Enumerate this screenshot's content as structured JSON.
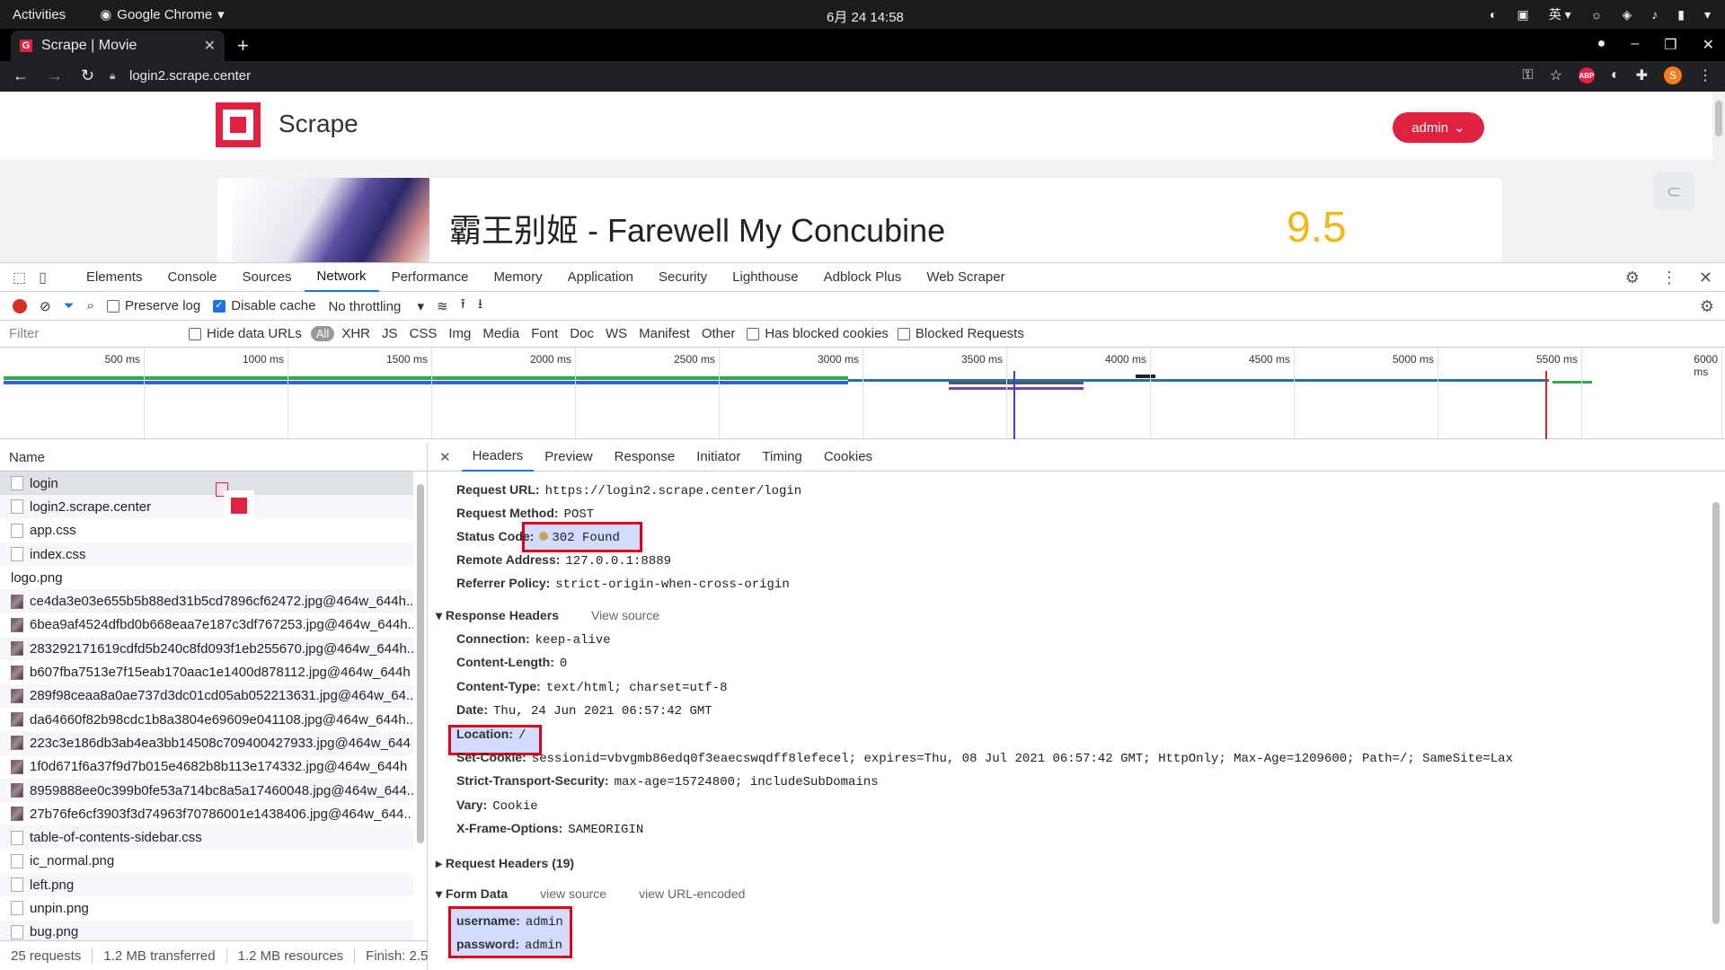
{
  "os_bar": {
    "activities": "Activities",
    "app": "Google Chrome",
    "clock": "6月 24 14:58",
    "ime": "英"
  },
  "browser": {
    "tab_title": "Scrape | Movie",
    "url": "login2.scrape.center"
  },
  "page": {
    "brand": "Scrape",
    "admin_button": "admin",
    "movie_title": "霸王别姬 - Farewell My Concubine",
    "score": "9.5"
  },
  "devtools": {
    "tabs": [
      "Elements",
      "Console",
      "Sources",
      "Network",
      "Performance",
      "Memory",
      "Application",
      "Security",
      "Lighthouse",
      "Adblock Plus",
      "Web Scraper"
    ],
    "active_tab": "Network",
    "toolbar": {
      "preserve_log": "Preserve log",
      "preserve_log_checked": false,
      "disable_cache": "Disable cache",
      "disable_cache_checked": true,
      "throttling": "No throttling"
    },
    "filter": {
      "placeholder": "Filter",
      "hide_data_urls": "Hide data URLs",
      "all": "All",
      "types": [
        "XHR",
        "JS",
        "CSS",
        "Img",
        "Media",
        "Font",
        "Doc",
        "WS",
        "Manifest",
        "Other"
      ],
      "has_blocked_cookies": "Has blocked cookies",
      "blocked_requests": "Blocked Requests"
    },
    "timeline_ticks": [
      "500 ms",
      "1000 ms",
      "1500 ms",
      "2000 ms",
      "2500 ms",
      "3000 ms",
      "3500 ms",
      "4000 ms",
      "4500 ms",
      "5000 ms",
      "5500 ms",
      "6000 ms"
    ],
    "name_header": "Name",
    "requests": [
      {
        "name": "login",
        "icon": "doc"
      },
      {
        "name": "login2.scrape.center",
        "icon": "doc"
      },
      {
        "name": "app.css",
        "icon": "doc"
      },
      {
        "name": "index.css",
        "icon": "doc"
      },
      {
        "name": "logo.png",
        "icon": "logo"
      },
      {
        "name": "ce4da3e03e655b5b88ed31b5cd7896cf62472.jpg@464w_644h..",
        "icon": "img"
      },
      {
        "name": "6bea9af4524dfbd0b668eaa7e187c3df767253.jpg@464w_644h..",
        "icon": "img"
      },
      {
        "name": "283292171619cdfd5b240c8fd093f1eb255670.jpg@464w_644h..",
        "icon": "img"
      },
      {
        "name": "b607fba7513e7f15eab170aac1e1400d878112.jpg@464w_644h",
        "icon": "img"
      },
      {
        "name": "289f98ceaa8a0ae737d3dc01cd05ab052213631.jpg@464w_64..",
        "icon": "img"
      },
      {
        "name": "da64660f82b98cdc1b8a3804e69609e041108.jpg@464w_644h..",
        "icon": "img"
      },
      {
        "name": "223c3e186db3ab4ea3bb14508c709400427933.jpg@464w_644",
        "icon": "img"
      },
      {
        "name": "1f0d671f6a37f9d7b015e4682b8b113e174332.jpg@464w_644h",
        "icon": "img"
      },
      {
        "name": "8959888ee0c399b0fe53a714bc8a5a17460048.jpg@464w_644..",
        "icon": "img"
      },
      {
        "name": "27b76fe6cf3903f3d74963f70786001e1438406.jpg@464w_644..",
        "icon": "img"
      },
      {
        "name": "table-of-contents-sidebar.css",
        "icon": "doc"
      },
      {
        "name": "ic_normal.png",
        "icon": "doc"
      },
      {
        "name": "left.png",
        "icon": "doc"
      },
      {
        "name": "unpin.png",
        "icon": "doc"
      },
      {
        "name": "bug.png",
        "icon": "doc"
      }
    ],
    "status": {
      "requests": "25 requests",
      "transferred": "1.2 MB transferred",
      "resources": "1.2 MB resources",
      "finish": "Finish: 2.5"
    },
    "detail_tabs": [
      "Headers",
      "Preview",
      "Response",
      "Initiator",
      "Timing",
      "Cookies"
    ],
    "general": {
      "request_url": {
        "k": "Request URL:",
        "v": "https://login2.scrape.center/login"
      },
      "request_method": {
        "k": "Request Method:",
        "v": "POST"
      },
      "status_code": {
        "k": "Status Code:",
        "v": "302 Found"
      },
      "remote_address": {
        "k": "Remote Address:",
        "v": "127.0.0.1:8889"
      },
      "referrer_policy": {
        "k": "Referrer Policy:",
        "v": "strict-origin-when-cross-origin"
      }
    },
    "response_headers_title": "Response Headers",
    "view_source": "View source",
    "response_headers": [
      {
        "k": "Connection:",
        "v": "keep-alive"
      },
      {
        "k": "Content-Length:",
        "v": "0"
      },
      {
        "k": "Content-Type:",
        "v": "text/html; charset=utf-8"
      },
      {
        "k": "Date:",
        "v": "Thu, 24 Jun 2021 06:57:42 GMT"
      },
      {
        "k": "Location:",
        "v": "/"
      },
      {
        "k": "Set-Cookie:",
        "v": "sessionid=vbvgmb86edq0f3eaecswqdff8lefecel; expires=Thu, 08 Jul 2021 06:57:42 GMT; HttpOnly; Max-Age=1209600; Path=/; SameSite=Lax"
      },
      {
        "k": "Strict-Transport-Security:",
        "v": "max-age=15724800; includeSubDomains"
      },
      {
        "k": "Vary:",
        "v": "Cookie"
      },
      {
        "k": "X-Frame-Options:",
        "v": "SAMEORIGIN"
      }
    ],
    "request_headers_title": "Request Headers (19)",
    "form_data_title": "Form Data",
    "form_view_source": "view source",
    "form_view_url": "view URL-encoded",
    "form_data": [
      {
        "k": "username:",
        "v": "admin"
      },
      {
        "k": "password:",
        "v": "admin"
      }
    ]
  }
}
